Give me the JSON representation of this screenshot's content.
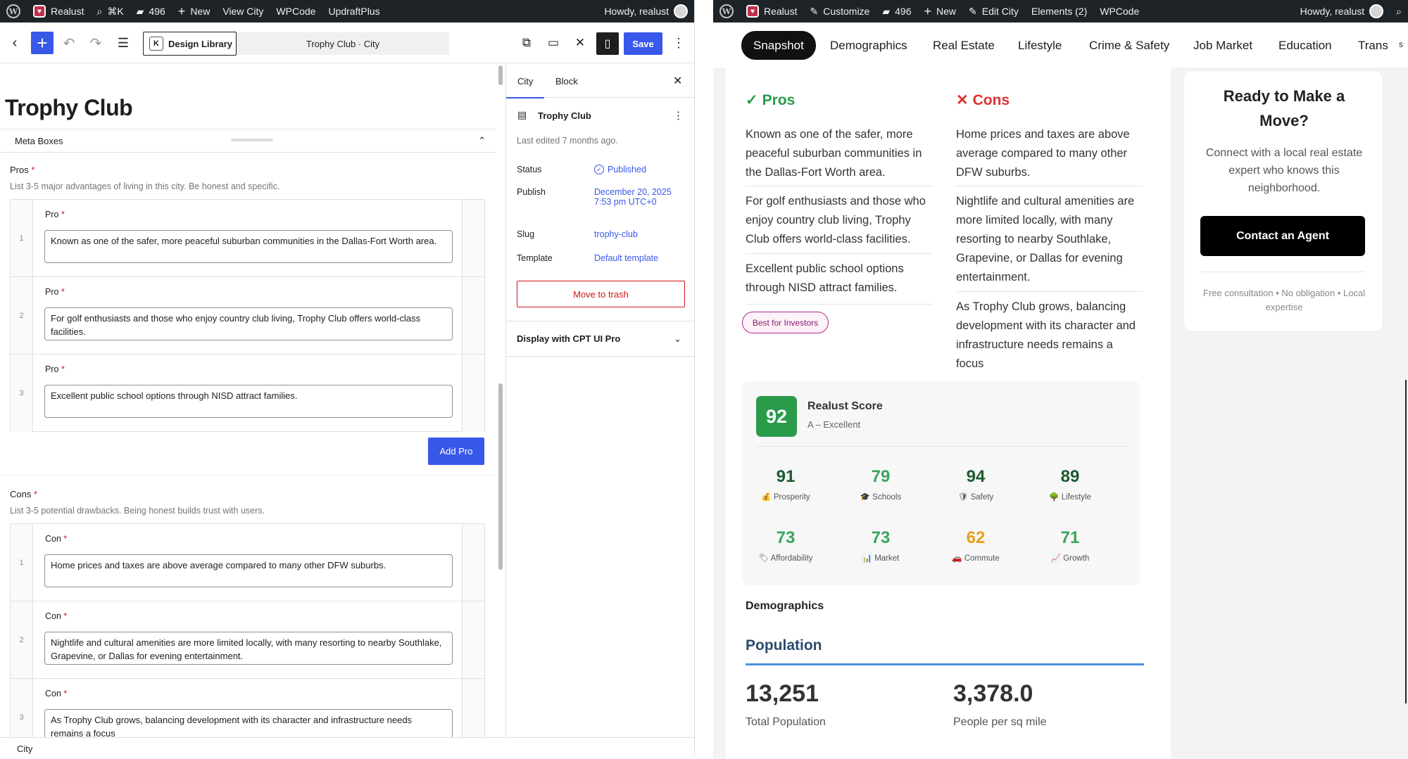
{
  "left": {
    "adminbar": {
      "site": "Realust",
      "search": "⌘K",
      "comments": "496",
      "new": "New",
      "view": "View City",
      "wpcode": "WPCode",
      "updraft": "UpdraftPlus",
      "howdy": "Howdy, realust"
    },
    "toolbar": {
      "design_library": "Design Library",
      "doc_title": "Trophy Club · City",
      "save": "Save"
    },
    "editor": {
      "post_title": "Trophy Club",
      "meta_boxes": "Meta Boxes",
      "pros_label": "Pros",
      "pros_desc": "List 3-5 major advantages of living in this city. Be honest and specific.",
      "pro_label": "Pro",
      "pros": [
        {
          "num": "1",
          "text": "Known as one of the safer, more peaceful suburban communities in the Dallas-Fort Worth area."
        },
        {
          "num": "2",
          "text": "For golf enthusiasts and those who enjoy country club living, Trophy Club offers world-class facilities."
        },
        {
          "num": "3",
          "text": "Excellent public school options through NISD attract families."
        }
      ],
      "add_pro": "Add Pro",
      "cons_label": "Cons",
      "cons_desc": "List 3-5 potential drawbacks. Being honest builds trust with users.",
      "con_label": "Con",
      "cons": [
        {
          "num": "1",
          "text": "Home prices and taxes are above average compared to many other DFW suburbs."
        },
        {
          "num": "2",
          "text": "Nightlife and cultural amenities are more limited locally, with many resorting to nearby Southlake, Grapevine, or Dallas for evening entertainment."
        },
        {
          "num": "3",
          "text": "As Trophy Club grows, balancing development with its character and infrastructure needs remains a focus"
        }
      ],
      "required_mark": "*"
    },
    "statusbar": "City",
    "sidebar": {
      "tab_city": "City",
      "tab_block": "Block",
      "post_name": "Trophy Club",
      "last_edited": "Last edited 7 months ago.",
      "status_k": "Status",
      "status_v": "Published",
      "publish_k": "Publish",
      "publish_v": "December 20, 2025 7:53 pm UTC+0",
      "slug_k": "Slug",
      "slug_v": "trophy-club",
      "template_k": "Template",
      "template_v": "Default template",
      "trash": "Move to trash",
      "panel": "Display with CPT UI Pro"
    }
  },
  "right": {
    "adminbar": {
      "site": "Realust",
      "customize": "Customize",
      "comments": "496",
      "new": "New",
      "edit": "Edit City",
      "elements": "Elements (2)",
      "wpcode": "WPCode",
      "howdy": "Howdy, realust"
    },
    "nav": [
      "Snapshot",
      "Demographics",
      "Real Estate",
      "Lifestyle",
      "Crime & Safety",
      "Job Market",
      "Education",
      "Trans"
    ],
    "nav_overflow": "s",
    "pros_title": "Pros",
    "cons_title": "Cons",
    "pros": [
      "Known as one of the safer, more peaceful suburban communities in the Dallas-Fort Worth area.",
      "For golf enthusiasts and those who enjoy country club living, Trophy Club offers world-class facilities.",
      "Excellent public school options through NISD attract families."
    ],
    "cons": [
      "Home prices and taxes are above average compared to many other DFW suburbs.",
      "Nightlife and cultural amenities are more limited locally, with many resorting to nearby Southlake, Grapevine, or Dallas for evening entertainment.",
      "As Trophy Club grows, balancing development with its character and infrastructure needs remains a focus"
    ],
    "badge": "Best for Investors",
    "score": {
      "value": "92",
      "title": "Realust Score",
      "grade": "A – Excellent",
      "cells": [
        {
          "n": "91",
          "icon": "💰",
          "label": "Prosperity",
          "color": "#1e5a2f"
        },
        {
          "n": "79",
          "icon": "🎓",
          "label": "Schools",
          "color": "#3aa55c"
        },
        {
          "n": "94",
          "icon": "🛡",
          "label": "Safety",
          "color": "#1e5a2f"
        },
        {
          "n": "89",
          "icon": "🌳",
          "label": "Lifestyle",
          "color": "#1e5a2f"
        },
        {
          "n": "73",
          "icon": "🏷",
          "label": "Affordability",
          "color": "#3aa55c"
        },
        {
          "n": "73",
          "icon": "📊",
          "label": "Market",
          "color": "#3aa55c"
        },
        {
          "n": "62",
          "icon": "🚗",
          "label": "Commute",
          "color": "#e6a020"
        },
        {
          "n": "71",
          "icon": "📈",
          "label": "Growth",
          "color": "#3aa55c"
        }
      ]
    },
    "demographics_heading": "Demographics",
    "population_heading": "Population",
    "stats": [
      {
        "value": "13,251",
        "label": "Total Population"
      },
      {
        "value": "3,378.0",
        "label": "People per sq mile"
      }
    ],
    "cta": {
      "title": "Ready to Make a Move?",
      "text": "Connect with a local real estate expert who knows this neighborhood.",
      "button": "Contact an Agent",
      "foot": "Free consultation • No obligation • Local expertise"
    }
  },
  "colors": {
    "accent": "#3858e9",
    "admin_bar": "#1d2327",
    "pros": "#2a9a4b",
    "cons": "#e03131"
  }
}
